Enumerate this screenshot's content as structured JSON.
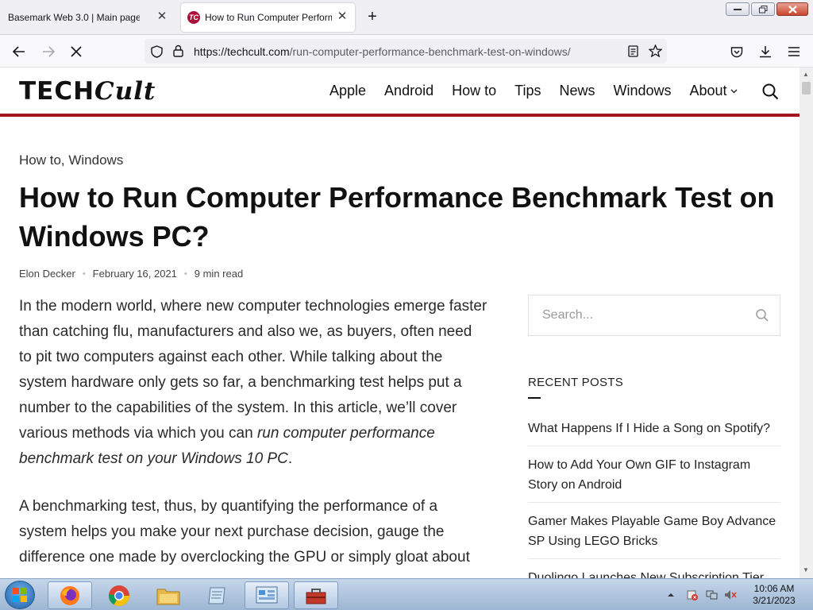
{
  "browser": {
    "tabs": [
      {
        "title": "Basemark Web 3.0 | Main page"
      },
      {
        "title": "How to Run Computer Perform",
        "favicon_text": "TC"
      }
    ],
    "url_host": "https://techcult.com",
    "url_path": "/run-computer-performance-benchmark-test-on-windows/"
  },
  "site": {
    "logo_left": "TECH",
    "logo_right": "Cult",
    "nav": [
      "Apple",
      "Android",
      "How to",
      "Tips",
      "News",
      "Windows",
      "About"
    ]
  },
  "article": {
    "categories": "How to, Windows",
    "title": "How to Run Computer Performance Benchmark Test on Windows PC?",
    "author": "Elon Decker",
    "date": "February 16, 2021",
    "read_time": "9 min read",
    "para1_plain": "In the modern world, where new computer technologies emerge faster than catching flu, manufacturers and also we, as buyers, often need to pit two computers against each other. While talking about the system hardware only gets so far, a benchmarking test helps put a number to the capabilities of the system. In this article, we’ll cover various methods via which you can ",
    "para1_em": "run computer performance benchmark test on your Windows 10 PC",
    "para1_end": ".",
    "para2": "A benchmarking test, thus, by quantifying the performance of a system helps you make your next purchase decision, gauge the difference one made by overclocking the GPU or simply gloat about"
  },
  "sidebar": {
    "search_placeholder": "Search...",
    "recent_heading": "RECENT POSTS",
    "recent_posts": [
      "What Happens If I Hide a Song on Spotify?",
      "How to Add Your Own GIF to Instagram Story on Android",
      "Gamer Makes Playable Game Boy Advance SP Using LEGO Bricks",
      "Duolingo Launches New Subscription Tier"
    ]
  },
  "taskbar": {
    "time": "10:06 AM",
    "date": "3/21/2023"
  },
  "colors": {
    "accent": "#a3151b",
    "favicon": "#a8123a"
  }
}
